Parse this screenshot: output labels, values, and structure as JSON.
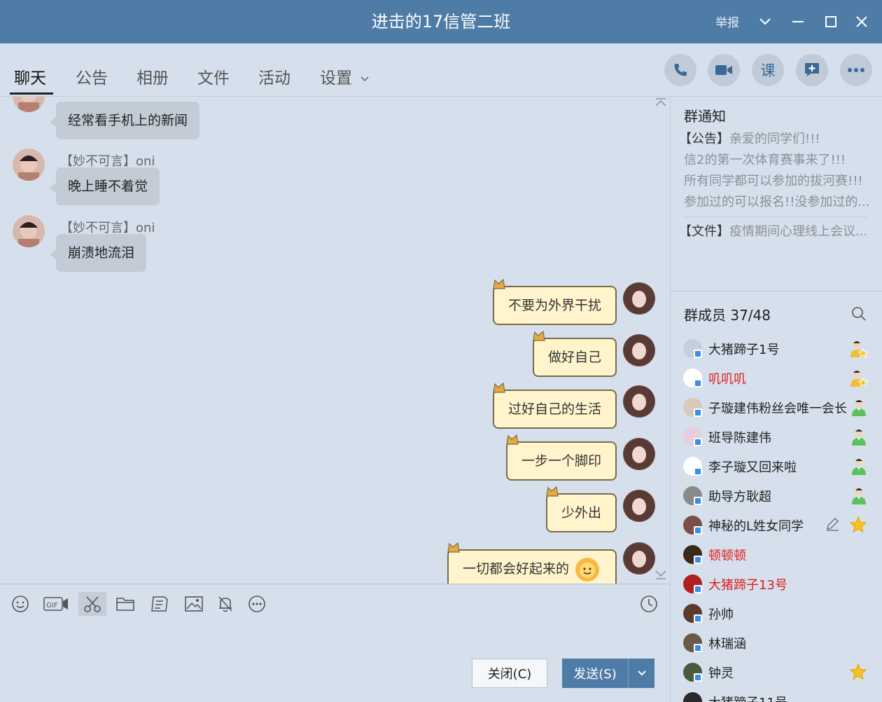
{
  "window": {
    "title": "进击的17信管二班",
    "report": "举报"
  },
  "tabs": [
    {
      "label": "聊天"
    },
    {
      "label": "公告"
    },
    {
      "label": "相册"
    },
    {
      "label": "文件"
    },
    {
      "label": "活动"
    },
    {
      "label": "设置"
    }
  ],
  "quick_actions": [
    {
      "icon": "phone-icon"
    },
    {
      "icon": "video-icon"
    },
    {
      "icon": "class-icon",
      "label": "课"
    },
    {
      "icon": "add-message-icon"
    },
    {
      "icon": "more-icon"
    }
  ],
  "chat": {
    "incoming": [
      {
        "sender": "",
        "text": "经常看手机上的新闻"
      },
      {
        "sender": "【妙不可言】oni",
        "text": "晚上睡不着觉"
      },
      {
        "sender": "【妙不可言】oni",
        "text": "崩溃地流泪"
      }
    ],
    "outgoing": [
      {
        "text": "不要为外界干扰"
      },
      {
        "text": "做好自己"
      },
      {
        "text": "过好自己的生活"
      },
      {
        "text": "一步一个脚印"
      },
      {
        "text": "少外出"
      },
      {
        "text": "一切都会好起来的"
      }
    ]
  },
  "toolbar": {
    "icons": [
      "emoji-icon",
      "gif-icon",
      "scissors-icon",
      "folder-icon",
      "doc-icon",
      "image-icon",
      "bell-icon",
      "more-circle-icon",
      "history-clock-icon"
    ]
  },
  "buttons": {
    "close": "关闭(C)",
    "send": "发送(S)"
  },
  "notice": {
    "title": "群通知",
    "lines": [
      {
        "tag": "【公告】",
        "text": "亲爱的同学们!!!"
      },
      {
        "tag": "",
        "text": "信2的第一次体育赛事来了!!!"
      },
      {
        "tag": "",
        "text": "所有同学都可以参加的拔河赛!!!"
      },
      {
        "tag": "",
        "text": "参加过的可以报名!!没参加过的..."
      }
    ],
    "file": {
      "tag": "【文件】",
      "text": "疫情期间心理线上会议..."
    }
  },
  "members": {
    "title": "群成员 37/48",
    "list": [
      {
        "name": "大猪蹄子1号",
        "role": "owner",
        "red": false,
        "avatar_color": "#c7cfd8"
      },
      {
        "name": "叽叽叽",
        "role": "owner",
        "red": true,
        "avatar_color": "#ffffff"
      },
      {
        "name": "子璇建伟粉丝会唯一会长",
        "role": "admin",
        "red": false,
        "avatar_color": "#d9c9b9"
      },
      {
        "name": "班导陈建伟",
        "role": "admin",
        "red": false,
        "avatar_color": "#e7cde0"
      },
      {
        "name": "李子璇又回来啦",
        "role": "admin",
        "red": false,
        "avatar_color": "#ffffff"
      },
      {
        "name": "助导方耿超",
        "role": "admin",
        "red": false,
        "avatar_color": "#8a8a8a"
      },
      {
        "name": "神秘的L姓女同学",
        "role": "star",
        "red": false,
        "avatar_color": "#7a4f48"
      },
      {
        "name": "顿顿顿",
        "role": "",
        "red": true,
        "avatar_color": "#3a2a1a"
      },
      {
        "name": "大猪蹄子13号",
        "role": "",
        "red": true,
        "avatar_color": "#b02020"
      },
      {
        "name": "孙帅",
        "role": "",
        "red": false,
        "avatar_color": "#5a3a2a"
      },
      {
        "name": "林瑞涵",
        "role": "",
        "red": false,
        "avatar_color": "#6a5a4a"
      },
      {
        "name": "钟灵",
        "role": "star",
        "red": false,
        "avatar_color": "#4a5a3a"
      },
      {
        "name": "大猪蹄子11号",
        "role": "",
        "red": false,
        "avatar_color": "#2a2a2a"
      }
    ]
  },
  "colors": {
    "titlebar": "#4f7ca6",
    "background": "#d6e0ec",
    "incoming_bubble": "#c3ccd6",
    "outgoing_bubble": "#fff4cc",
    "highlight_name": "#e01c1c",
    "send_button": "#4f7ca6"
  }
}
